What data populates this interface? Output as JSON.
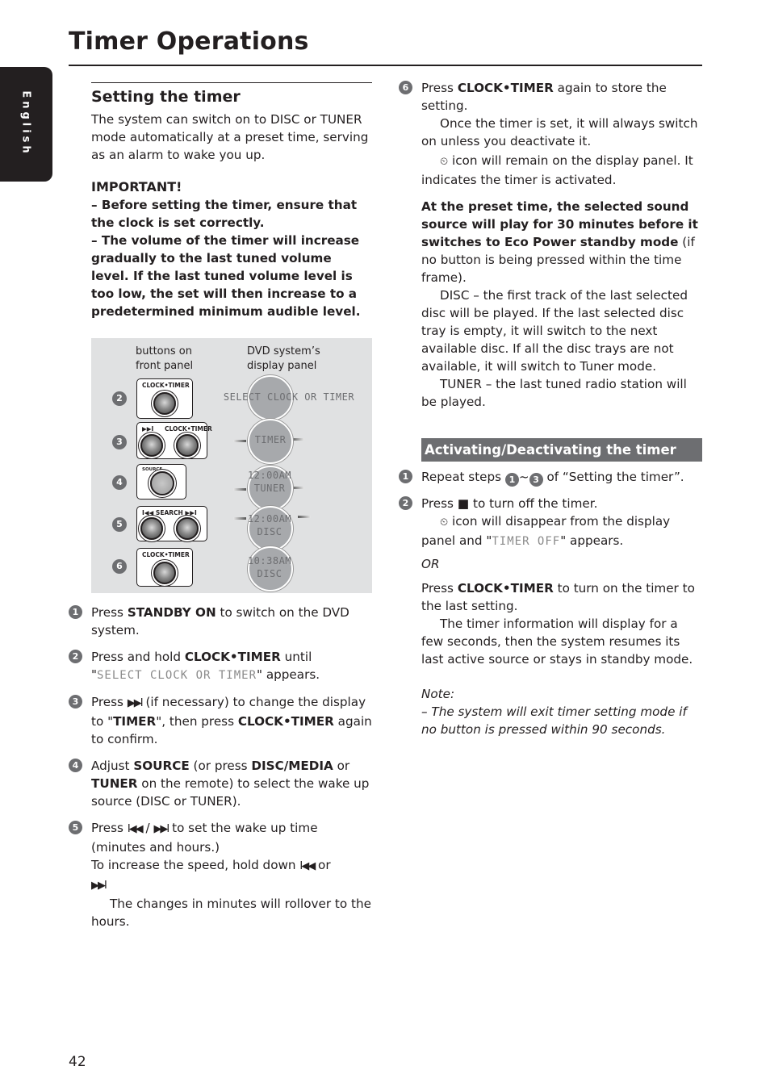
{
  "header": {
    "title": "Timer Operations",
    "language_tab": "English"
  },
  "setting_section": {
    "title": "Setting the timer",
    "intro": "The system can switch on to DISC or TUNER mode automatically at a preset time, serving as an alarm to wake you up.",
    "important": {
      "heading": "IMPORTANT!",
      "item1": "–  Before setting the timer, ensure that the clock is set correctly.",
      "item2": "–  The volume of the timer will increase gradually to the last tuned volume level. If the last tuned volume level is too low, the set will then increase to a predetermined minimum audible level."
    },
    "diagram": {
      "col1_label_line1": "buttons on",
      "col1_label_line2": "front panel",
      "col2_label_line1": "DVD system’s",
      "col2_label_line2": "display panel",
      "rows": [
        {
          "step": "2",
          "buttons": [
            "CLOCK•TIMER"
          ],
          "display_line1": "SELECT CLOCK OR TIMER",
          "display_line2": ""
        },
        {
          "step": "3",
          "buttons": [
            "▶▶I",
            "CLOCK•TIMER"
          ],
          "display_line1": "TIMER",
          "display_line2": ""
        },
        {
          "step": "4",
          "buttons": [
            "SOURCE"
          ],
          "display_line1": "12:00AM",
          "display_line2": "TUNER"
        },
        {
          "step": "5",
          "buttons": [
            "I◀◀ SEARCH ▶▶I"
          ],
          "display_line1": "12:00AM",
          "display_line2": "DISC"
        },
        {
          "step": "6",
          "buttons": [
            "CLOCK•TIMER"
          ],
          "display_line1": "10:38AM",
          "display_line2": "DISC"
        }
      ]
    },
    "steps": [
      {
        "num": "1",
        "pre": "Press ",
        "bold": "STANDBY ON",
        "post": " to switch on the DVD system."
      },
      {
        "num": "2",
        "pre": "Press and hold ",
        "bold": "CLOCK•TIMER",
        "post": " until",
        "lcd": "SELECT CLOCK OR TIMER",
        "post2": " appears."
      },
      {
        "num": "3",
        "pre": "Press ",
        "symbol": "▶▶I",
        "mid": " (if necessary) to change the display to \"",
        "bold": "TIMER",
        "mid2": "\", then press ",
        "bold2": "CLOCK•TIMER",
        "post": " again to confirm."
      },
      {
        "num": "4",
        "pre": "Adjust ",
        "bold": "SOURCE",
        "mid": " (or press ",
        "bold2": "DISC/MEDIA",
        "mid2": " or ",
        "bold3": "TUNER",
        "post": " on the remote) to select the wake up source (DISC or TUNER)."
      },
      {
        "num": "5",
        "pre": "Press ",
        "symbol": "I◀◀",
        "sep": " / ",
        "symbol2": "▶▶I",
        "post": " to set the wake up time (minutes and hours.)",
        "line2": "To increase the speed, hold down ",
        "line2_symbol": "I◀◀",
        "line2_mid": " or ",
        "line2_symbol2": "▶▶I",
        "note": "The changes in minutes will rollover to the hours."
      }
    ]
  },
  "right_column": {
    "step6": {
      "num": "6",
      "pre": "Press ",
      "bold": "CLOCK•TIMER",
      "post": " again to store the setting.",
      "note1": "Once the timer is set, it will always switch on unless you deactivate it.",
      "clock_icon": "⏲",
      "note2": " icon will remain on the display panel.  It indicates the timer is activated."
    },
    "preset_bold": "At the preset time, the selected sound source will play for 30 minutes before it switches to Eco Power standby mode",
    "preset_rest": " (if no button is being pressed within the time frame).",
    "disc_note": "DISC – the first track of the last selected disc will be played.  If the last selected disc tray is empty, it will switch to the next available disc.  If all the disc trays are not available, it will switch to Tuner mode.",
    "tuner_note": "TUNER – the last tuned radio station will be played.",
    "activating": {
      "title": "Activating/Deactivating the timer",
      "step1_pre": "Repeat steps ",
      "step1_from": "1",
      "step1_tilde": "~",
      "step1_to": "3",
      "step1_post": " of “Setting the timer”.",
      "step2_pre": "Press ",
      "step2_symbol": "■",
      "step2_post": "  to turn off the timer.",
      "step2_note_icon": "⏲",
      "step2_note": " icon will disappear from the display panel and \"",
      "step2_lcd": "TIMER OFF",
      "step2_note_end": "\" appears.",
      "or": "OR",
      "alt_pre": "Press ",
      "alt_bold": "CLOCK•TIMER",
      "alt_post": " to turn on the timer to the last setting.",
      "alt_note": "The timer information will display for a few seconds, then the system resumes its last active source or stays in standby mode."
    },
    "note": {
      "label": "Note:",
      "text": "–  The system will exit timer setting mode if no button is pressed within 90 seconds."
    }
  },
  "footer": {
    "page_number": "42"
  }
}
